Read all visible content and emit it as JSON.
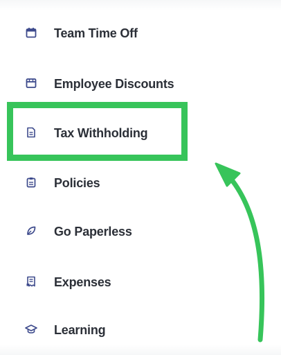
{
  "menu": {
    "items": [
      {
        "label": "Team Time Off",
        "icon": "calendar-icon"
      },
      {
        "label": "Employee Discounts",
        "icon": "store-icon"
      },
      {
        "label": "Tax Withholding",
        "icon": "document-icon"
      },
      {
        "label": "Policies",
        "icon": "clipboard-icon"
      },
      {
        "label": "Go Paperless",
        "icon": "leaf-icon"
      },
      {
        "label": "Expenses",
        "icon": "receipt-icon"
      },
      {
        "label": "Learning",
        "icon": "graduation-cap-icon"
      }
    ]
  },
  "annotation": {
    "highlight_color": "#37c45a",
    "highlighted_item": "Tax Withholding"
  },
  "colors": {
    "icon": "#3d4a8c",
    "text": "#2b2f37"
  }
}
